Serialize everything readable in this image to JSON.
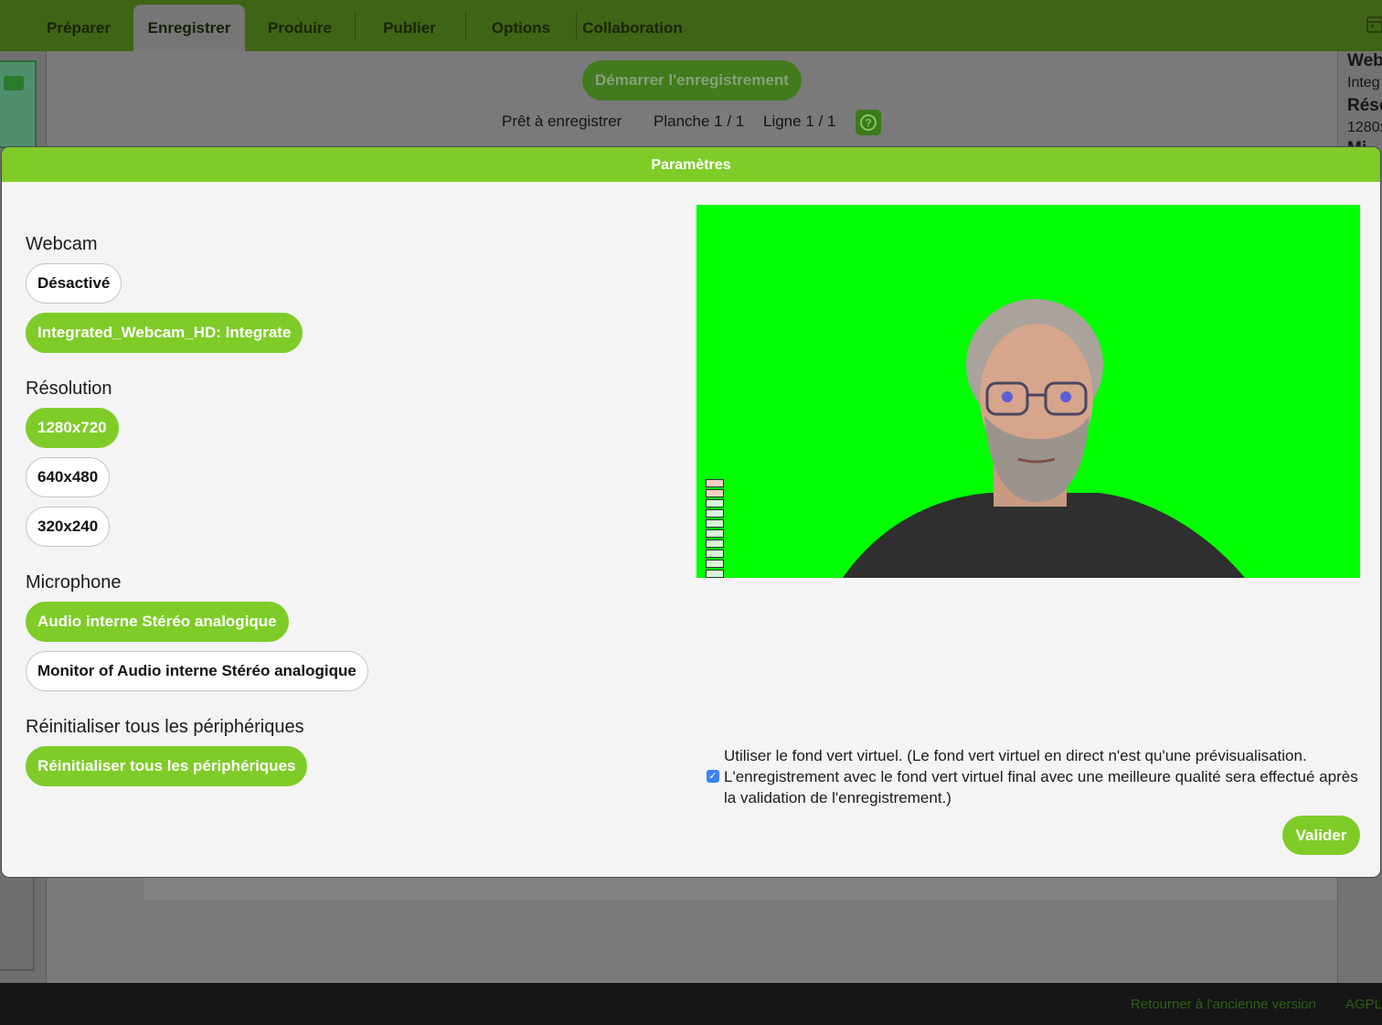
{
  "nav": {
    "tabs": [
      {
        "label": "Préparer"
      },
      {
        "label": "Enregistrer",
        "active": true
      },
      {
        "label": "Produire"
      },
      {
        "label": "Publier"
      },
      {
        "label": "Options"
      },
      {
        "label": "Collaboration"
      }
    ]
  },
  "background": {
    "record_button": "Démarrer l'enregistrement",
    "status": "Prêt à enregistrer",
    "slide": "Planche 1 / 1",
    "line": "Ligne 1 / 1",
    "right_panel": {
      "webcam_title": "Web",
      "webcam_value": "Integ",
      "resolution_title": "Réso",
      "resolution_value": "1280x",
      "mic_title": "Mi"
    },
    "footer": {
      "old_version": "Retourner à l'ancienne version",
      "license": "AGPL"
    }
  },
  "modal": {
    "title": "Paramètres",
    "webcam": {
      "title": "Webcam",
      "options": [
        {
          "label": "Désactivé",
          "selected": false
        },
        {
          "label": "Integrated_Webcam_HD: Integrate",
          "selected": true
        }
      ]
    },
    "resolution": {
      "title": "Résolution",
      "options": [
        {
          "label": "1280x720",
          "selected": true
        },
        {
          "label": "640x480",
          "selected": false
        },
        {
          "label": "320x240",
          "selected": false
        }
      ]
    },
    "microphone": {
      "title": "Microphone",
      "options": [
        {
          "label": "Audio interne Stéréo analogique",
          "selected": true
        },
        {
          "label": "Monitor of Audio interne Stéréo analogique",
          "selected": false
        }
      ]
    },
    "reset": {
      "title": "Réinitialiser tous les périphériques",
      "button": "Réinitialiser tous les périphériques"
    },
    "green_screen": {
      "checked": true,
      "label": "Utiliser le fond vert virtuel. (Le fond vert virtuel en direct n'est qu'une prévisualisation. L'enregistrement avec le fond vert virtuel final avec une meilleure qualité sera effectué après la validation de l'enregistrement.)"
    },
    "validate": "Valider"
  },
  "colors": {
    "accent": "#7fcc29",
    "topbar": "#3f6416",
    "chroma": "#00ff00",
    "checkbox": "#3b82f6"
  }
}
